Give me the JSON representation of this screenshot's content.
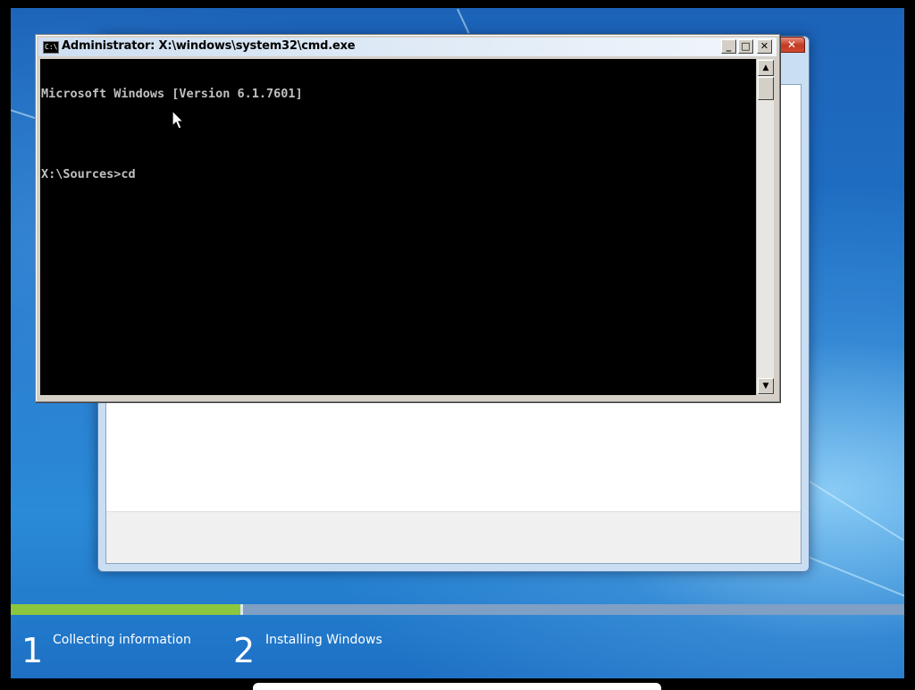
{
  "cmd_window": {
    "title": "Administrator: X:\\windows\\system32\\cmd.exe",
    "icon_text": "C:\\",
    "minimize_glyph": "_",
    "maximize_glyph": "□",
    "close_glyph": "✕",
    "console_lines": [
      "Microsoft Windows [Version 6.1.7601]",
      "",
      "X:\\Sources>cd"
    ]
  },
  "setup_window": {
    "close_glyph": "✕"
  },
  "progress": {
    "fraction_complete": 0.26,
    "steps": [
      {
        "number": "1",
        "label": "Collecting information"
      },
      {
        "number": "2",
        "label": "Installing Windows"
      }
    ]
  },
  "colors": {
    "progress_done": "#8cc63f",
    "progress_remaining": "#7f9fc4",
    "console_background": "#000000",
    "console_text": "#c0c0c0"
  }
}
